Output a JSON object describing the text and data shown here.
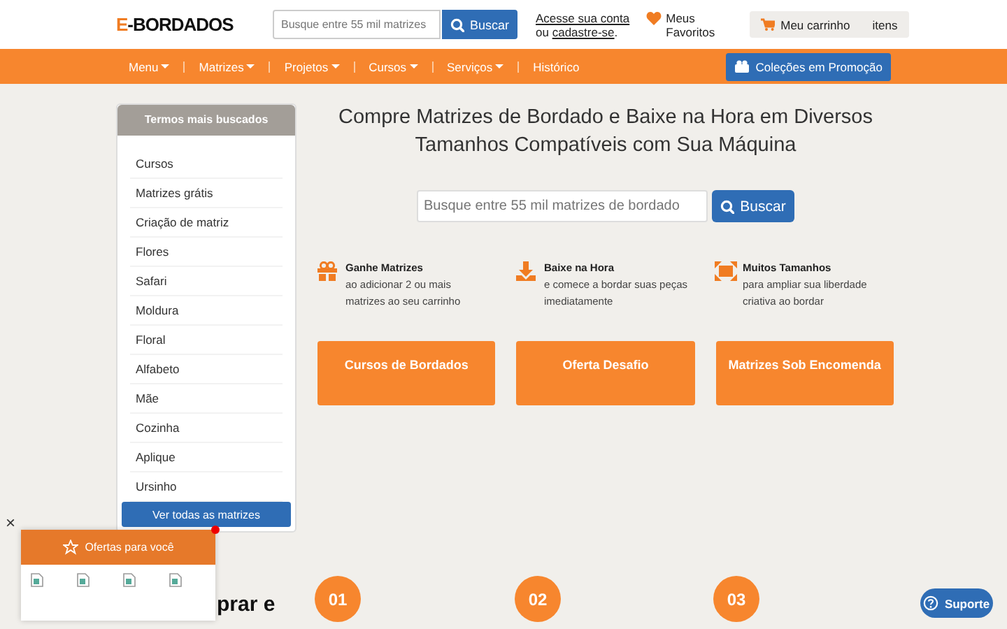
{
  "header": {
    "logo": "E-BORDADOS",
    "search": {
      "placeholder": "Busque entre 55 mil matrizes",
      "button": "Buscar"
    },
    "account": {
      "line1": "Acesse sua conta",
      "line2_prefix": "ou ",
      "line2_link": "cadastre-se",
      "line2_suffix": "."
    },
    "favorites": "Meus Favoritos",
    "cart": {
      "label": "Meu carrinho",
      "count": "itens"
    }
  },
  "nav": {
    "items": [
      {
        "label": "Menu",
        "dropdown": true
      },
      {
        "label": "Matrizes",
        "dropdown": true
      },
      {
        "label": "Projetos",
        "dropdown": true
      },
      {
        "label": "Cursos",
        "dropdown": true
      },
      {
        "label": "Serviços",
        "dropdown": true
      },
      {
        "label": "Histórico",
        "dropdown": false
      }
    ],
    "promo": "Coleções em Promoção"
  },
  "sidebar": {
    "title": "Termos mais buscados",
    "items": [
      "Cursos",
      "Matrizes grátis",
      "Criação de matriz",
      "Flores",
      "Safari",
      "Moldura",
      "Floral",
      "Alfabeto",
      "Mãe",
      "Cozinha",
      "Aplique",
      "Ursinho"
    ],
    "button": "Ver todas as matrizes"
  },
  "main": {
    "title": "Compre Matrizes de Bordado e Baixe na Hora em Diversos Tamanhos Compatíveis com Sua Máquina",
    "search": {
      "placeholder": "Busque entre 55 mil matrizes de bordado",
      "button": "Buscar"
    },
    "features": [
      {
        "kind": "gift",
        "title": "Ganhe Matrizes",
        "text": "ao adicionar 2 ou mais matrizes ao seu carrinho"
      },
      {
        "kind": "download",
        "title": "Baixe na Hora",
        "text": "e comece a bordar suas peças imediatamente"
      },
      {
        "kind": "resize",
        "title": "Muitos Tamanhos",
        "text": "para ampliar sua liberdade criativa ao bordar"
      }
    ],
    "cards": [
      "Cursos de Bordados",
      "Oferta Desafio",
      "Matrizes Sob Encomenda"
    ]
  },
  "steps": {
    "heading": "prar e",
    "numbers": [
      "01",
      "02",
      "03"
    ]
  },
  "popup": {
    "title": "Ofertas para você",
    "close": "×",
    "images": [
      {
        "kind": "broken_image"
      },
      {
        "kind": "broken_image"
      },
      {
        "kind": "broken_image"
      },
      {
        "kind": "broken_image"
      }
    ]
  },
  "support": "Suporte"
}
